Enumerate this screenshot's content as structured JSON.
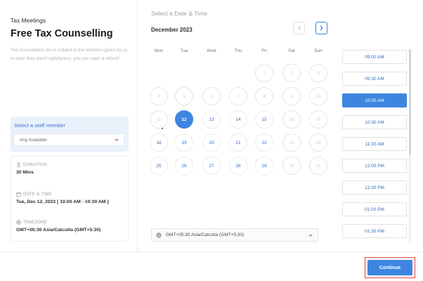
{
  "service": {
    "label": "Tax Meetings",
    "title": "Free Tax Counselling",
    "description": "The Consultation fee is subject to the solutions given by us. In case they aren't satisfactory, you can claim a refund!"
  },
  "staff": {
    "label": "Select a staff member",
    "selected": "Any Available"
  },
  "details": {
    "duration_label": "DURATION",
    "duration_value": "30 Mins",
    "datetime_label": "DATE & TIME",
    "datetime_value": "Tue, Dec 12, 2023 [ 10:00 AM - 10:30 AM ]",
    "timezone_label": "TIMEZONE",
    "timezone_value": "GMT+05:30 Asia/Calcutta (GMT+5:30)"
  },
  "calendar": {
    "heading": "Select a Date & Time",
    "month": "December 2023",
    "weekdays": [
      "Mon",
      "Tue",
      "Wed",
      "Thu",
      "Fri",
      "Sat",
      "Sun"
    ],
    "selected_day": "12",
    "rows": [
      [
        "",
        "",
        "",
        "",
        "1",
        "2",
        "3"
      ],
      [
        "4",
        "5",
        "6",
        "7",
        "8",
        "9",
        "10"
      ],
      [
        "11",
        "12",
        "13",
        "14",
        "15",
        "16",
        "17"
      ],
      [
        "18",
        "19",
        "20",
        "21",
        "22",
        "23",
        "24"
      ],
      [
        "25",
        "26",
        "27",
        "28",
        "29",
        "30",
        "31"
      ]
    ],
    "available_days": [
      "12",
      "13",
      "14",
      "15",
      "18",
      "19",
      "20",
      "21",
      "22",
      "25",
      "26",
      "27",
      "28",
      "29"
    ],
    "timezone": "GMT+05:30 Asia/Calcutta (GMT+5:30)"
  },
  "slots": {
    "items": [
      "09:00 AM",
      "09:30 AM",
      "10:00 AM",
      "10:30 AM",
      "11:30 AM",
      "12:00 PM",
      "12:30 PM",
      "01:00 PM",
      "01:30 PM"
    ],
    "selected": "10:00 AM"
  },
  "footer": {
    "continue_label": "Continue"
  },
  "colors": {
    "accent": "#3d86e0",
    "highlight_outline": "#e5453b"
  }
}
